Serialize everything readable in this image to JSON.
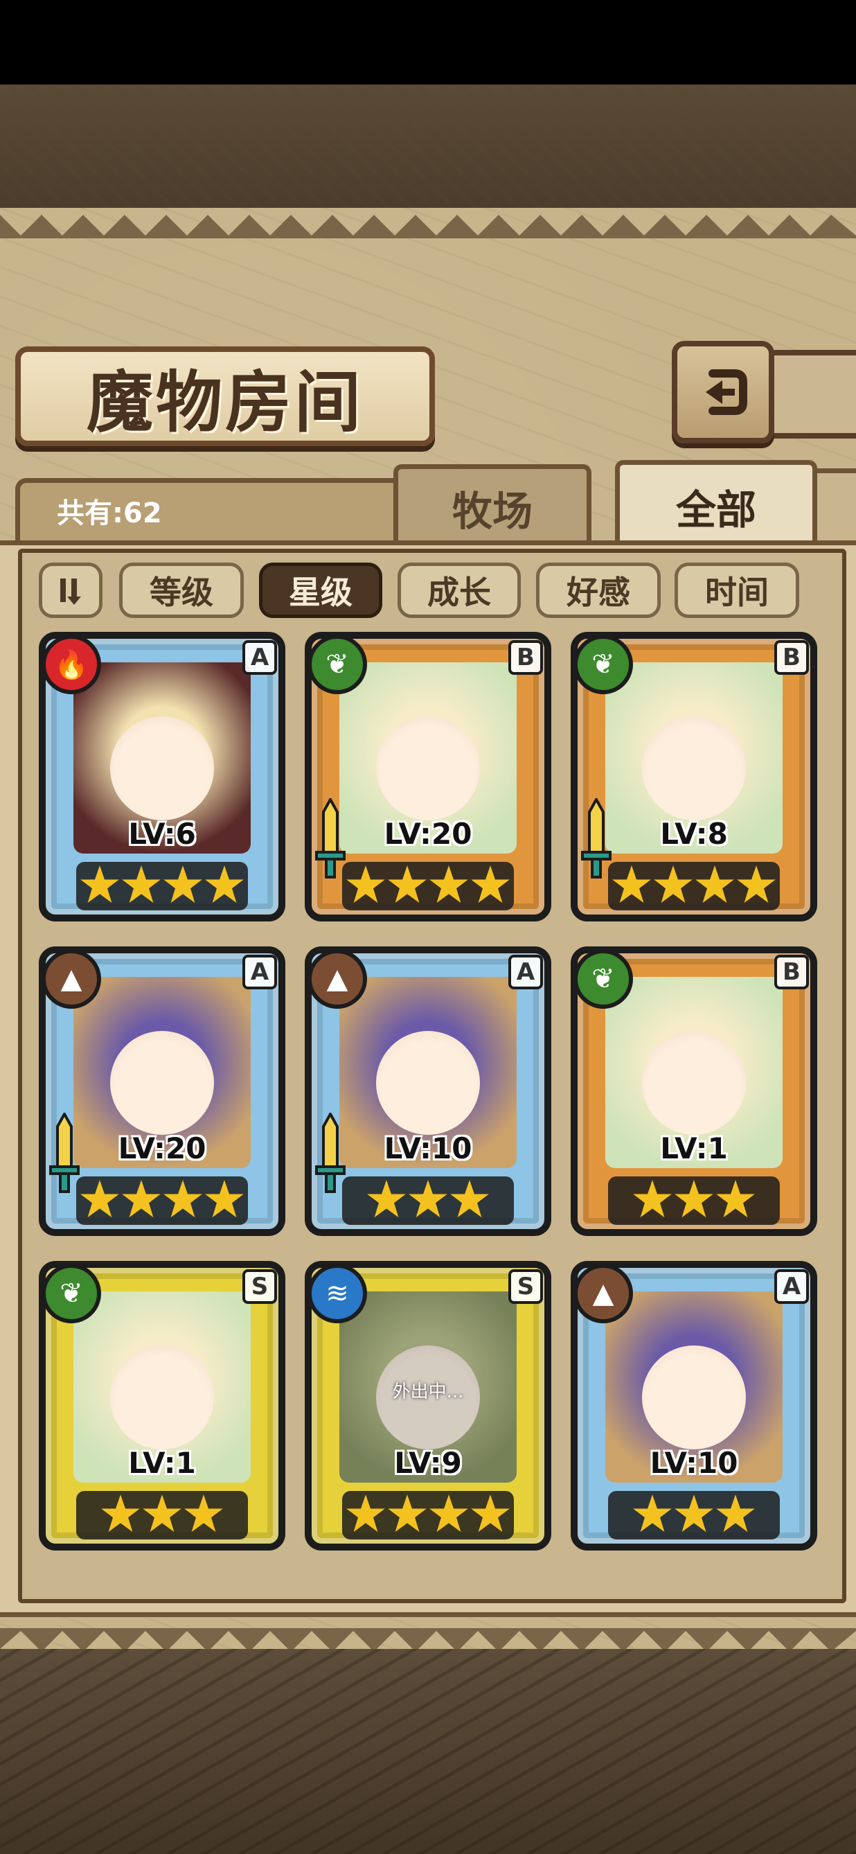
{
  "header": {
    "title": "魔物房间",
    "total_count": "共有:62",
    "back_icon": "return-arrow-icon"
  },
  "tabs": [
    {
      "label": "牧场",
      "active": false
    },
    {
      "label": "全部",
      "active": true
    }
  ],
  "sort": {
    "order_icon": "sort-order-icon",
    "options": [
      {
        "label": "等级",
        "active": false
      },
      {
        "label": "星级",
        "active": true
      },
      {
        "label": "成长",
        "active": false
      },
      {
        "label": "好感",
        "active": false
      },
      {
        "label": "时间",
        "active": false
      }
    ]
  },
  "monsters": [
    {
      "level": "LV:6",
      "rarity": "A",
      "element": "fire",
      "stars": 4,
      "equipped": false,
      "away": ""
    },
    {
      "level": "LV:20",
      "rarity": "B",
      "element": "leaf",
      "stars": 4,
      "equipped": true,
      "away": ""
    },
    {
      "level": "LV:8",
      "rarity": "B",
      "element": "leaf",
      "stars": 4,
      "equipped": true,
      "away": ""
    },
    {
      "level": "LV:20",
      "rarity": "A",
      "element": "earth",
      "stars": 4,
      "equipped": true,
      "away": ""
    },
    {
      "level": "LV:10",
      "rarity": "A",
      "element": "earth",
      "stars": 3,
      "equipped": true,
      "away": ""
    },
    {
      "level": "LV:1",
      "rarity": "B",
      "element": "leaf",
      "stars": 3,
      "equipped": false,
      "away": ""
    },
    {
      "level": "LV:1",
      "rarity": "S",
      "element": "leaf",
      "stars": 3,
      "equipped": false,
      "away": ""
    },
    {
      "level": "LV:9",
      "rarity": "S",
      "element": "water",
      "stars": 4,
      "equipped": false,
      "away": "外出中..."
    },
    {
      "level": "LV:10",
      "rarity": "A",
      "element": "earth",
      "stars": 3,
      "equipped": false,
      "away": ""
    }
  ],
  "colors": {
    "frame_a": "#8ec5e6",
    "frame_b": "#e1963e",
    "frame_s": "#e6d13a",
    "fire": "#d8262a",
    "leaf": "#3d8a2f",
    "earth": "#7b4e34",
    "water": "#2a78c8"
  }
}
